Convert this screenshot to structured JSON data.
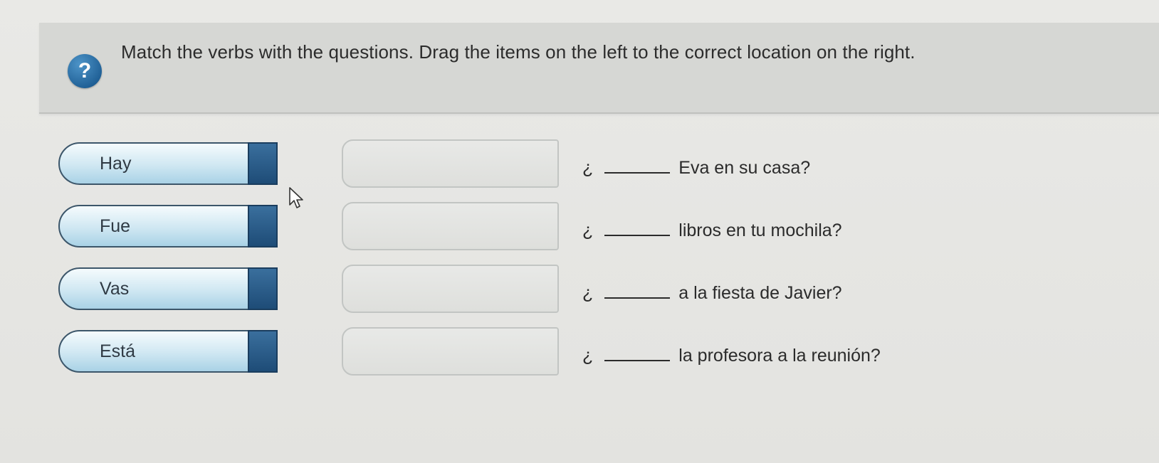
{
  "instruction": {
    "help_icon_glyph": "?",
    "text": "Match the verbs with the questions. Drag the items on the left to the correct location on the right."
  },
  "verbs": [
    {
      "label": "Hay"
    },
    {
      "label": "Fue"
    },
    {
      "label": "Vas"
    },
    {
      "label": "Está"
    }
  ],
  "questions": [
    {
      "prefix": "¿",
      "suffix": "Eva en su casa?"
    },
    {
      "prefix": "¿",
      "suffix": "libros en tu mochila?"
    },
    {
      "prefix": "¿",
      "suffix": "a la fiesta de Javier?"
    },
    {
      "prefix": "¿",
      "suffix": "la profesora a la reunión?"
    }
  ],
  "colors": {
    "help_icon": "#1f5f95",
    "tile_handle": "#1e4c77",
    "tile_fill": "#cfe7f2"
  },
  "icons": {
    "help": "help-question-icon",
    "cursor": "mouse-pointer-icon"
  }
}
